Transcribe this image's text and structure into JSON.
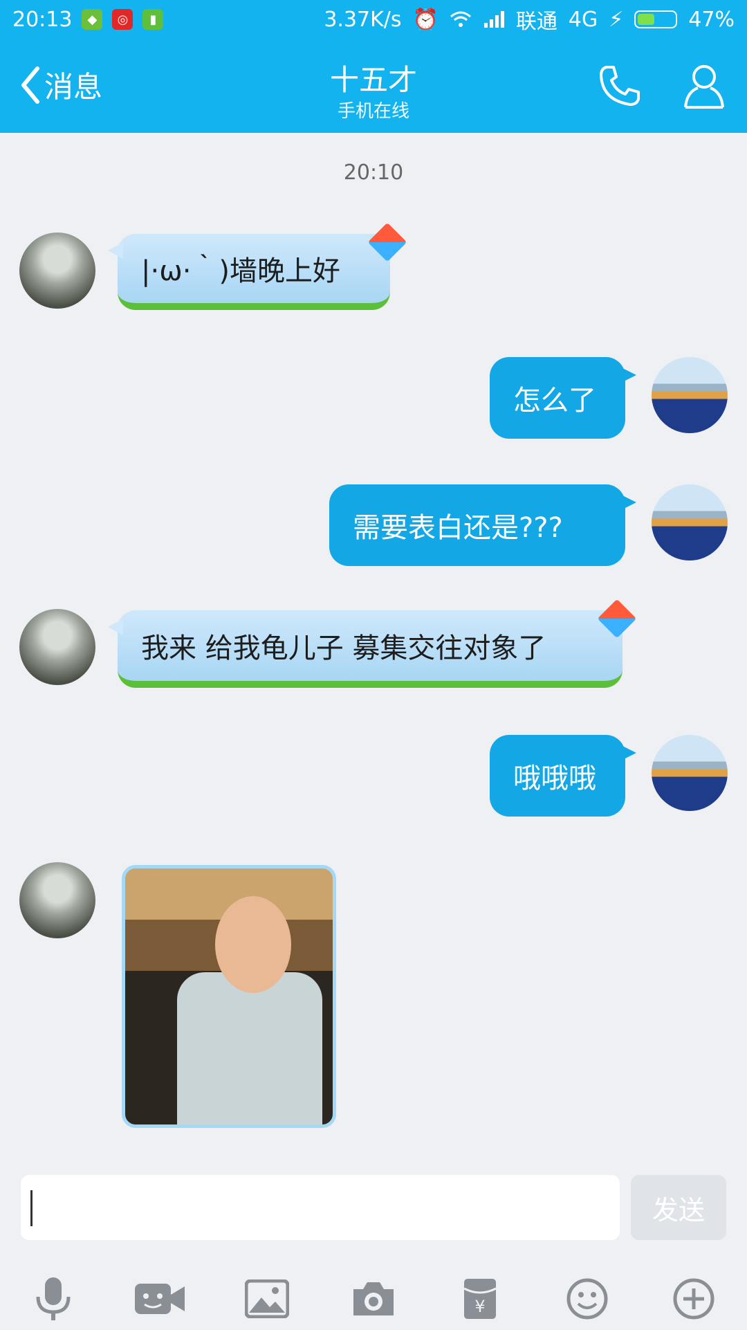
{
  "status_bar": {
    "time": "20:13",
    "speed": "3.37K/s",
    "carrier": "联通",
    "network": "4G",
    "battery": "47%",
    "battery_level": 0.47,
    "icons": [
      "shield-icon",
      "netease-music-icon",
      "sim-icon",
      "alarm-icon",
      "wifi-icon",
      "signal-icon",
      "charging-icon",
      "battery-icon"
    ]
  },
  "header": {
    "back_label": "消息",
    "title": "十五才",
    "subtitle": "手机在线",
    "call_icon": "phone-icon",
    "profile_icon": "person-icon"
  },
  "chat": {
    "timestamp": "20:10",
    "messages": [
      {
        "side": "left",
        "text": "|·ω·｀)墙晚上好"
      },
      {
        "side": "right",
        "text": "怎么了"
      },
      {
        "side": "right",
        "text": "需要表白还是???"
      },
      {
        "side": "left",
        "text": "我来  给我龟儿子  募集交往对象了"
      },
      {
        "side": "right",
        "text": "哦哦哦"
      },
      {
        "side": "left",
        "type": "image"
      }
    ]
  },
  "input": {
    "value": "",
    "send_label": "发送"
  },
  "toolbar": {
    "icons": [
      "microphone-icon",
      "video-call-icon",
      "image-icon",
      "camera-icon",
      "red-packet-icon",
      "emoji-icon",
      "plus-icon"
    ]
  },
  "colors": {
    "accent": "#12b3ef",
    "bubble_out": "#13a7e6",
    "bubble_in": "#cfe8fb"
  }
}
